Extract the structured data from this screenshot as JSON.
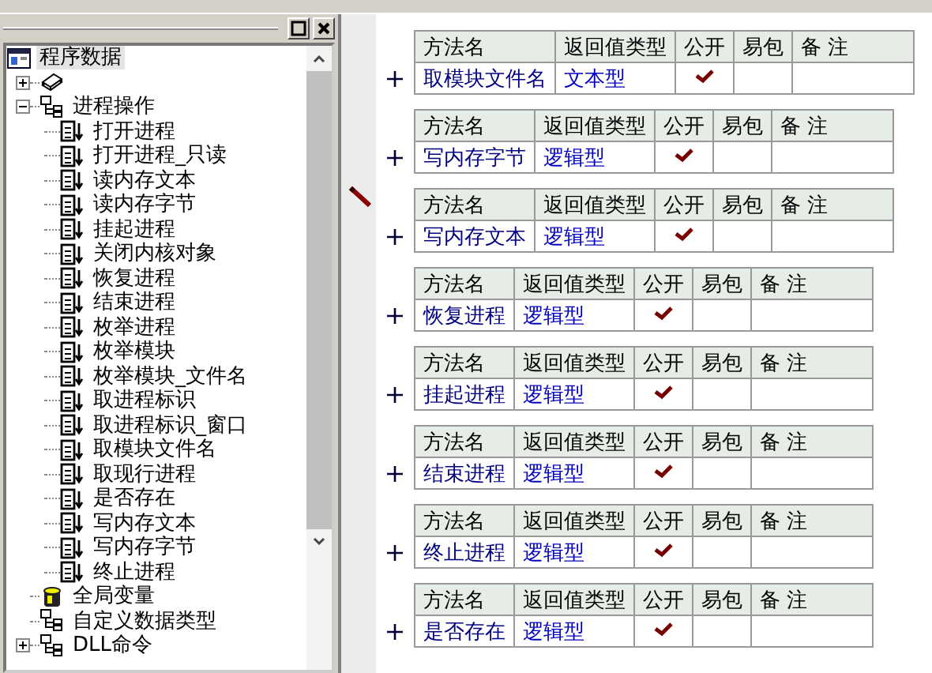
{
  "tree": {
    "title": "程序数据",
    "items": [
      {
        "kind": "library",
        "expanded": false
      },
      {
        "kind": "module",
        "label": "进程操作",
        "expanded": true,
        "children": [
          {
            "label": "打开进程"
          },
          {
            "label": "打开进程_只读"
          },
          {
            "label": "读内存文本"
          },
          {
            "label": "读内存字节"
          },
          {
            "label": "挂起进程"
          },
          {
            "label": "关闭内核对象"
          },
          {
            "label": "恢复进程"
          },
          {
            "label": "结束进程"
          },
          {
            "label": "枚举进程"
          },
          {
            "label": "枚举模块"
          },
          {
            "label": "枚举模块_文件名"
          },
          {
            "label": "取进程标识"
          },
          {
            "label": "取进程标识_窗口"
          },
          {
            "label": "取模块文件名"
          },
          {
            "label": "取现行进程"
          },
          {
            "label": "是否存在"
          },
          {
            "label": "写内存文本"
          },
          {
            "label": "写内存字节"
          },
          {
            "label": "终止进程"
          }
        ]
      },
      {
        "kind": "globals",
        "label": "全局变量"
      },
      {
        "kind": "types",
        "label": "自定义数据类型"
      },
      {
        "kind": "dll",
        "label": "DLL命令",
        "expanded": false
      }
    ]
  },
  "methods": [
    {
      "columns": [
        "方法名",
        "返回值类型",
        "公开",
        "易包",
        "备 注"
      ],
      "name": "取模块文件名",
      "return_type": "文本型",
      "public": true,
      "editing": false
    },
    {
      "columns": [
        "方法名",
        "返回值类型",
        "公开",
        "易包",
        "备 注"
      ],
      "name": "写内存字节",
      "return_type": "逻辑型",
      "public": true,
      "editing": false
    },
    {
      "columns": [
        "方法名",
        "返回值类型",
        "公开",
        "易包",
        "备 注"
      ],
      "name": "写内存文本",
      "return_type": "逻辑型",
      "public": true,
      "editing": true
    },
    {
      "columns": [
        "方法名",
        "返回值类型",
        "公开",
        "易包",
        "备 注"
      ],
      "name": "恢复进程",
      "return_type": "逻辑型",
      "public": true,
      "editing": false
    },
    {
      "columns": [
        "方法名",
        "返回值类型",
        "公开",
        "易包",
        "备 注"
      ],
      "name": "挂起进程",
      "return_type": "逻辑型",
      "public": true,
      "editing": false
    },
    {
      "columns": [
        "方法名",
        "返回值类型",
        "公开",
        "易包",
        "备 注"
      ],
      "name": "结束进程",
      "return_type": "逻辑型",
      "public": true,
      "editing": false
    },
    {
      "columns": [
        "方法名",
        "返回值类型",
        "公开",
        "易包",
        "备 注"
      ],
      "name": "终止进程",
      "return_type": "逻辑型",
      "public": true,
      "editing": false
    },
    {
      "columns": [
        "方法名",
        "返回值类型",
        "公开",
        "易包",
        "备 注"
      ],
      "name": "是否存在",
      "return_type": "逻辑型",
      "public": true,
      "editing": false
    }
  ]
}
